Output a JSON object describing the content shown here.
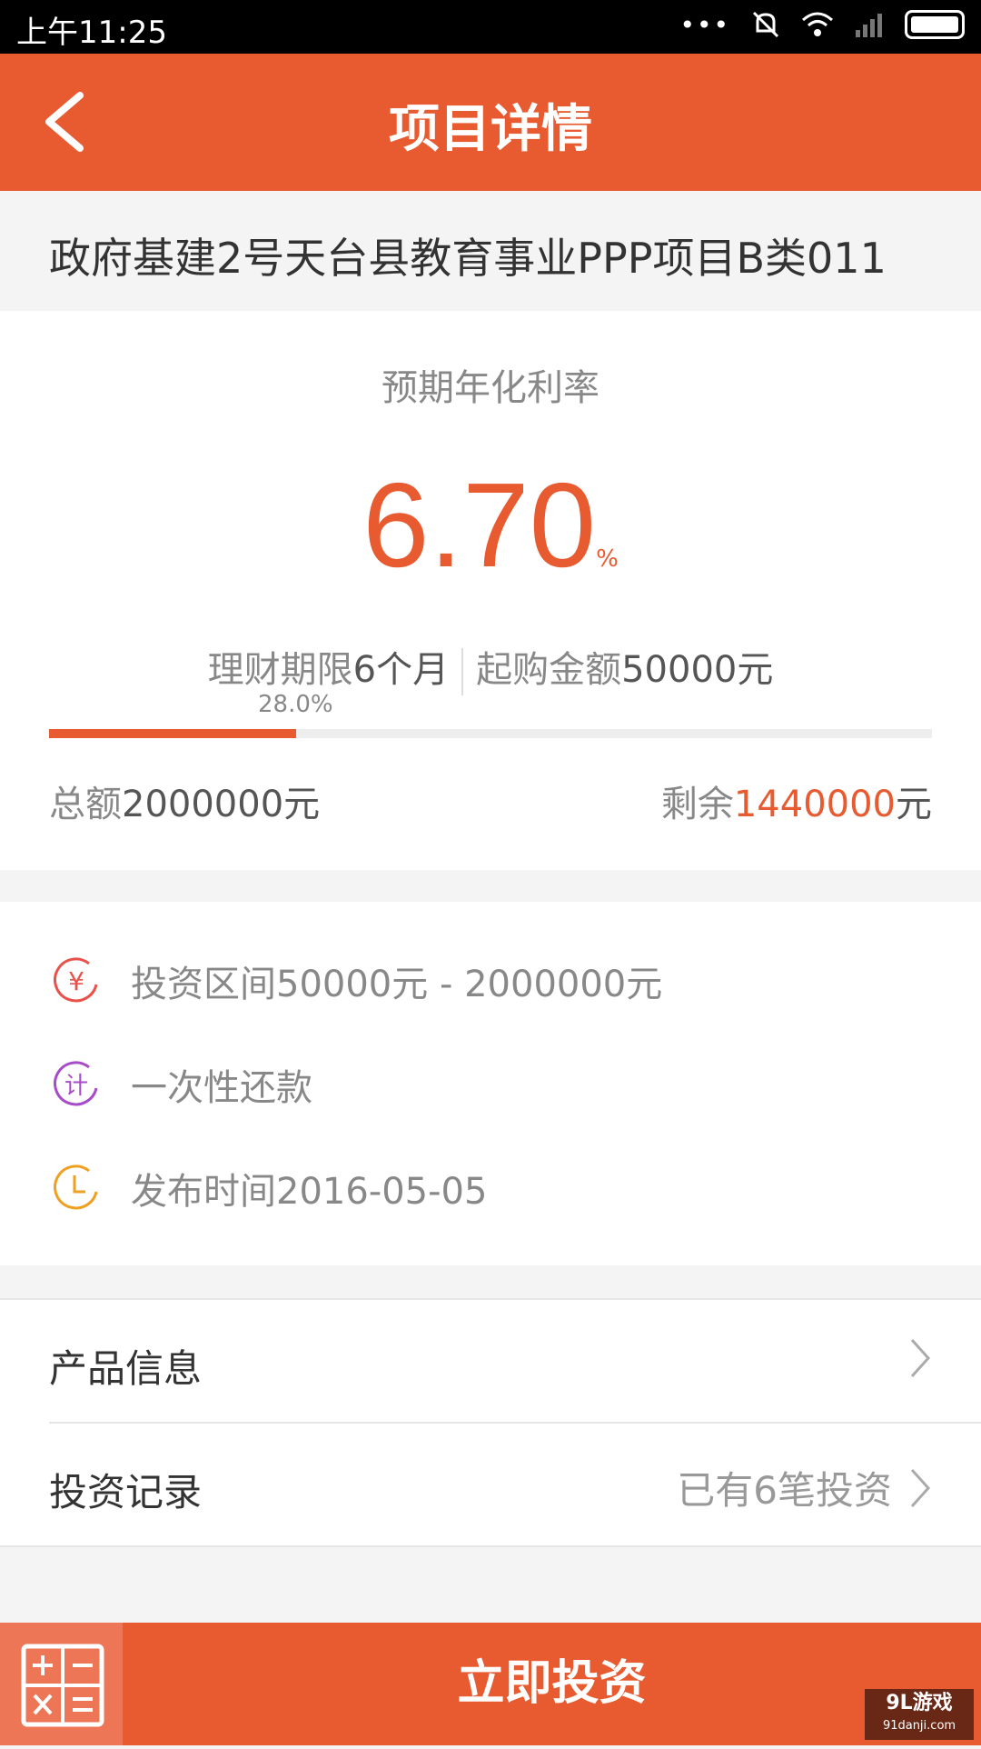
{
  "status_bar": {
    "time": "上午11:25",
    "dots": "•••"
  },
  "header": {
    "title": "项目详情"
  },
  "project": {
    "title": "政府基建2号天台县教育事业PPP项目B类011"
  },
  "rate": {
    "label": "预期年化利率",
    "value": "6.70",
    "unit": "%",
    "term_label": "理财期限",
    "term_value": "6个月",
    "min_label": "起购金额",
    "min_value": "50000元",
    "progress_text": "28.0%",
    "progress": 28.0,
    "total_label": "总额",
    "total_value": "2000000元",
    "remaining_label": "剩余",
    "remaining_value": "1440000",
    "remaining_unit": "元"
  },
  "info": {
    "range": "投资区间50000元 - 2000000元",
    "repay": "一次性还款",
    "publish": "发布时间2016-05-05",
    "icons": [
      "yuan-icon",
      "calc-badge-icon",
      "clock-icon"
    ]
  },
  "menu": {
    "product_info": "产品信息",
    "invest_records": "投资记录",
    "invest_count": "已有6笔投资"
  },
  "bottom": {
    "invest_button": "立即投资"
  },
  "watermark": {
    "line1": "9L游戏",
    "line2": "91danji.com"
  },
  "colors": {
    "accent": "#e85a2f",
    "purple": "#a64cc9",
    "orange": "#f0a020",
    "red_icon": "#e8524a"
  }
}
